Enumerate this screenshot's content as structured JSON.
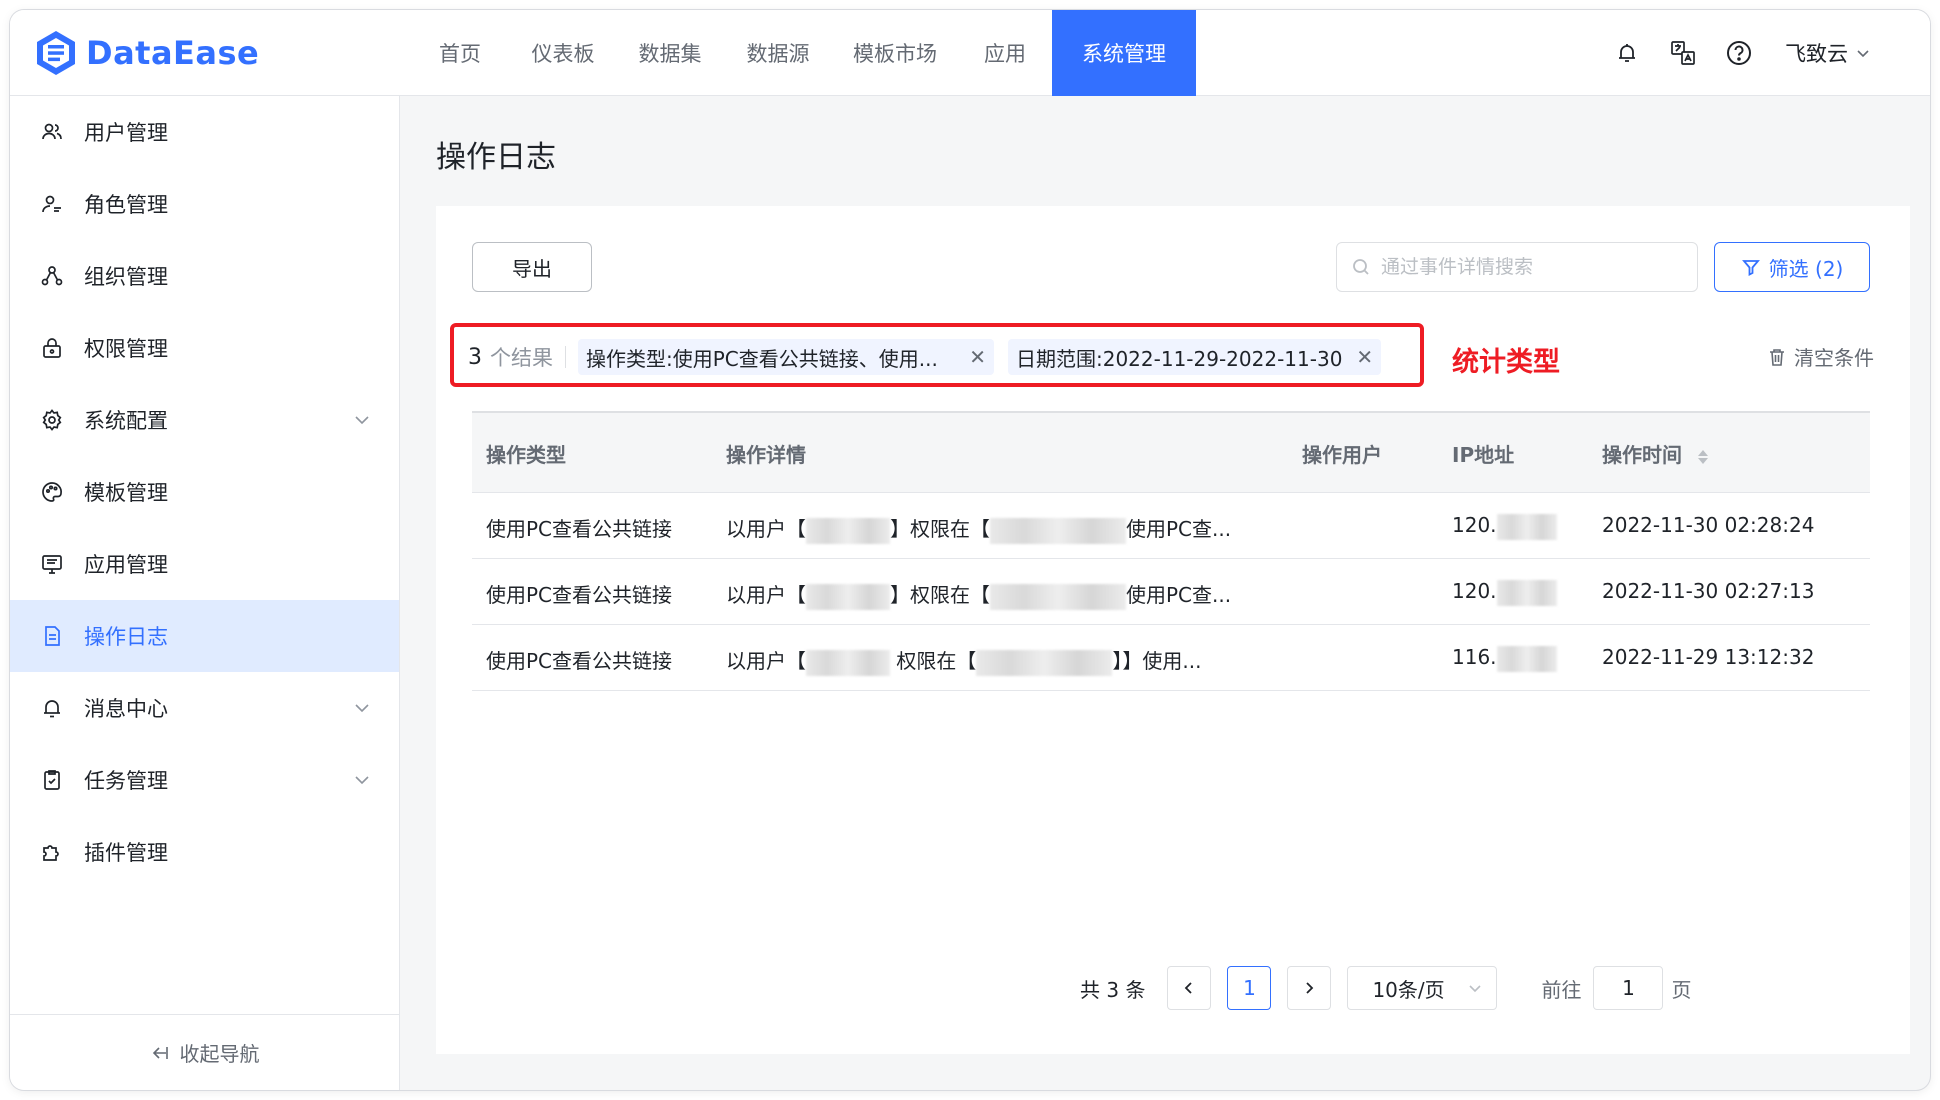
{
  "app": {
    "logo_text": "DataEase"
  },
  "nav": {
    "items": [
      {
        "label": "首页"
      },
      {
        "label": "仪表板"
      },
      {
        "label": "数据集"
      },
      {
        "label": "数据源"
      },
      {
        "label": "模板市场"
      },
      {
        "label": "应用"
      },
      {
        "label": "系统管理",
        "active": true
      }
    ]
  },
  "header": {
    "user_name": "飞致云"
  },
  "sidebar": {
    "items": [
      {
        "label": "用户管理",
        "icon": "users-icon"
      },
      {
        "label": "角色管理",
        "icon": "role-icon"
      },
      {
        "label": "组织管理",
        "icon": "org-icon"
      },
      {
        "label": "权限管理",
        "icon": "lock-icon"
      },
      {
        "label": "系统配置",
        "icon": "gear-icon",
        "expandable": true
      },
      {
        "label": "模板管理",
        "icon": "palette-icon"
      },
      {
        "label": "应用管理",
        "icon": "monitor-icon"
      },
      {
        "label": "操作日志",
        "icon": "document-icon",
        "active": true
      },
      {
        "label": "消息中心",
        "icon": "bell-icon",
        "expandable": true
      },
      {
        "label": "任务管理",
        "icon": "clipboard-icon",
        "expandable": true
      },
      {
        "label": "插件管理",
        "icon": "puzzle-icon"
      }
    ],
    "collapse_label": "收起导航"
  },
  "page": {
    "title": "操作日志"
  },
  "toolbar": {
    "export_label": "导出",
    "search_placeholder": "通过事件详情搜索",
    "filter_label": "筛选 (2)"
  },
  "filters": {
    "count": "3",
    "count_label": "个结果",
    "tags": [
      {
        "text": "操作类型:使用PC查看公共链接、使用..."
      },
      {
        "text": "日期范围:2022-11-29-2022-11-30"
      }
    ],
    "clear_label": "清空条件",
    "annotation": "统计类型"
  },
  "table": {
    "headers": [
      "操作类型",
      "操作详情",
      "操作用户",
      "IP地址",
      "操作时间"
    ],
    "rows": [
      {
        "type": "使用PC查看公共链接",
        "detail_a": "以用户【",
        "detail_b": "】权限在【",
        "detail_c": "使用PC查...",
        "user": "",
        "ip": "120.",
        "time": "2022-11-30 02:28:24"
      },
      {
        "type": "使用PC查看公共链接",
        "detail_a": "以用户【",
        "detail_b": "】权限在【",
        "detail_c": "使用PC查...",
        "user": "",
        "ip": "120.",
        "time": "2022-11-30 02:27:13"
      },
      {
        "type": "使用PC查看公共链接",
        "detail_a": "以用户【",
        "detail_b": " 权限在【",
        "detail_c": "】】使用...",
        "user": "",
        "ip": "116.",
        "time": "2022-11-29 13:12:32"
      }
    ]
  },
  "pagination": {
    "total_label": "共 3 条",
    "current_page": "1",
    "page_size": "10条/页",
    "goto_label": "前往",
    "goto_value": "1",
    "page_unit": "页"
  },
  "colors": {
    "accent": "#3370ff",
    "annotation": "#ee1c24"
  }
}
